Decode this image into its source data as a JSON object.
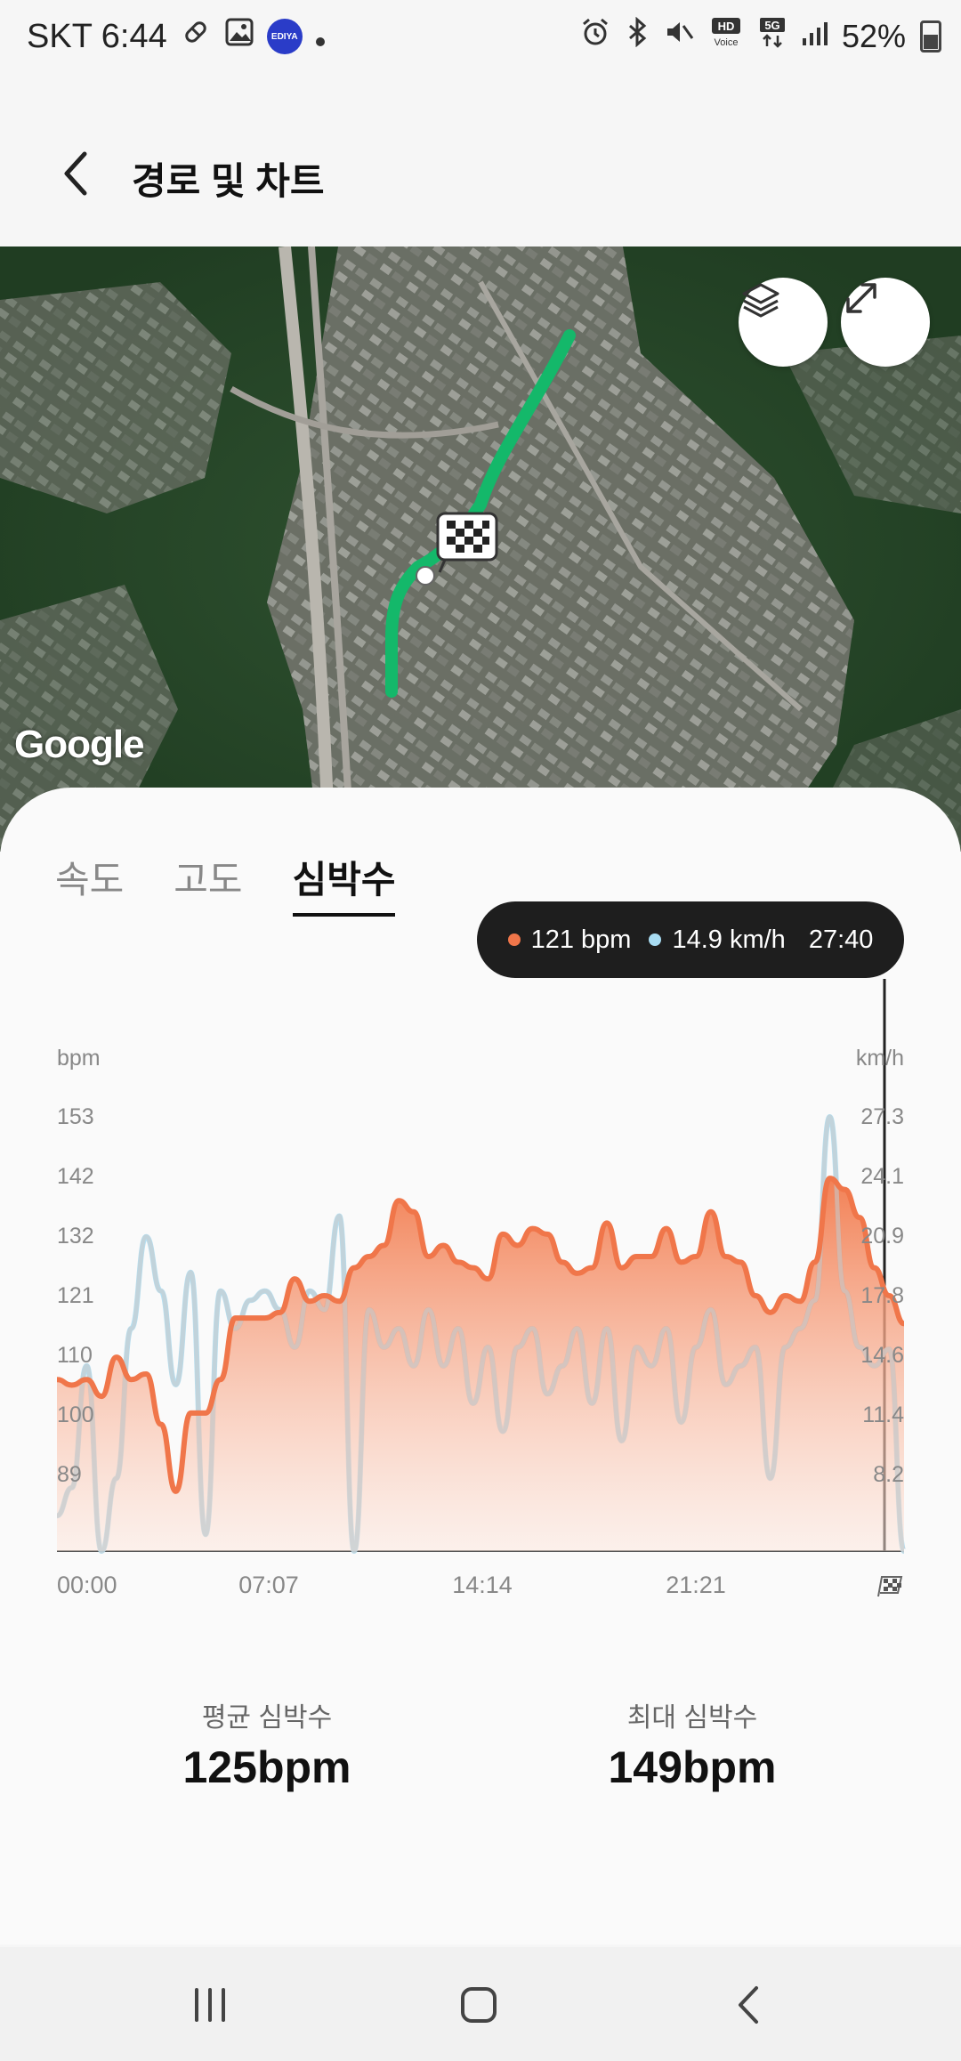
{
  "status_bar": {
    "carrier_time": "SKT 6:44",
    "ediya": "EDIYA",
    "hd_voice": "HD Voice",
    "network": "5G",
    "battery": "52%"
  },
  "header": {
    "title": "경로 및 차트"
  },
  "map": {
    "attribution": "Google"
  },
  "tabs": [
    {
      "label": "속도",
      "active": false
    },
    {
      "label": "고도",
      "active": false
    },
    {
      "label": "심박수",
      "active": true
    }
  ],
  "tooltip": {
    "heart_rate": "121 bpm",
    "speed": "14.9 km/h",
    "time": "27:40",
    "hr_color": "#f0764a",
    "speed_color": "#a8dcf2"
  },
  "chart_data": {
    "type": "area",
    "left_axis_label": "bpm",
    "right_axis_label": "km/h",
    "left_ticks": [
      153,
      142,
      132,
      121,
      110,
      100,
      89
    ],
    "right_ticks": [
      "27.3",
      "24.1",
      "20.9",
      "17.8",
      "14.6",
      "11.4",
      "8.2"
    ],
    "x_ticks": [
      "00:00",
      "07:07",
      "14:14",
      "21:21"
    ],
    "x_range_min": [
      0,
      28.5
    ],
    "y_left_range": [
      78,
      160
    ],
    "series": [
      {
        "name": "심박수",
        "unit": "bpm",
        "color": "#f0764a",
        "x": [
          0,
          0.5,
          1,
          1.5,
          2,
          2.5,
          3,
          3.5,
          4,
          4.5,
          5,
          5.5,
          6,
          6.5,
          7,
          7.5,
          8,
          8.5,
          9,
          9.5,
          10,
          10.5,
          11,
          11.5,
          12,
          12.5,
          13,
          13.5,
          14,
          14.5,
          15,
          15.5,
          16,
          16.5,
          17,
          17.5,
          18,
          18.5,
          19,
          19.5,
          20,
          20.5,
          21,
          21.5,
          22,
          22.5,
          23,
          23.5,
          24,
          24.5,
          25,
          25.5,
          26,
          26.5,
          27,
          27.5,
          28,
          28.5
        ],
        "values": [
          106,
          105,
          106,
          103,
          110,
          106,
          107,
          98,
          86,
          100,
          100,
          106,
          117,
          117,
          117,
          118,
          124,
          120,
          121,
          120,
          126,
          128,
          130,
          138,
          136,
          128,
          130,
          127,
          126,
          124,
          132,
          130,
          133,
          132,
          127,
          125,
          126,
          134,
          126,
          128,
          128,
          133,
          127,
          128,
          136,
          128,
          127,
          121,
          118,
          121,
          120,
          127,
          142,
          140,
          135,
          126,
          121,
          116
        ]
      },
      {
        "name": "속도",
        "unit": "km/h",
        "color": "#a8dcf2",
        "x": [
          0,
          0.5,
          1,
          1.5,
          2,
          2.5,
          3,
          3.5,
          4,
          4.5,
          5,
          5.5,
          6,
          6.5,
          7,
          7.5,
          8,
          8.5,
          9,
          9.5,
          10,
          10.5,
          11,
          11.5,
          12,
          12.5,
          13,
          13.5,
          14,
          14.5,
          15,
          15.5,
          16,
          16.5,
          17,
          17.5,
          18,
          18.5,
          19,
          19.5,
          20,
          20.5,
          21,
          21.5,
          22,
          22.5,
          23,
          23.5,
          24,
          24.5,
          25,
          25.5,
          26,
          26.5,
          27,
          27.5,
          28,
          28.5
        ],
        "values": [
          6.0,
          7.5,
          14.0,
          4.0,
          8.0,
          16.0,
          20.9,
          18.0,
          13.0,
          19.0,
          5.0,
          18.0,
          16.0,
          17.5,
          18.0,
          17.0,
          15.0,
          18.0,
          17.0,
          22.0,
          3.0,
          17.0,
          15.0,
          16.0,
          14.0,
          17.0,
          14.0,
          16.0,
          12.0,
          15.0,
          10.5,
          15.0,
          16.0,
          12.5,
          14.0,
          16.0,
          12.0,
          16.0,
          10.0,
          15.0,
          14.0,
          16.0,
          11.0,
          15.0,
          17.0,
          13.0,
          14.0,
          15.0,
          8.0,
          15.0,
          16.0,
          17.5,
          27.3,
          18.0,
          15.0,
          14.0,
          14.9,
          3.0
        ]
      }
    ],
    "cursor_time": "27:40"
  },
  "stats": {
    "avg_label": "평균 심박수",
    "avg_value": "125",
    "avg_unit": "bpm",
    "max_label": "최대 심박수",
    "max_value": "149",
    "max_unit": "bpm"
  }
}
